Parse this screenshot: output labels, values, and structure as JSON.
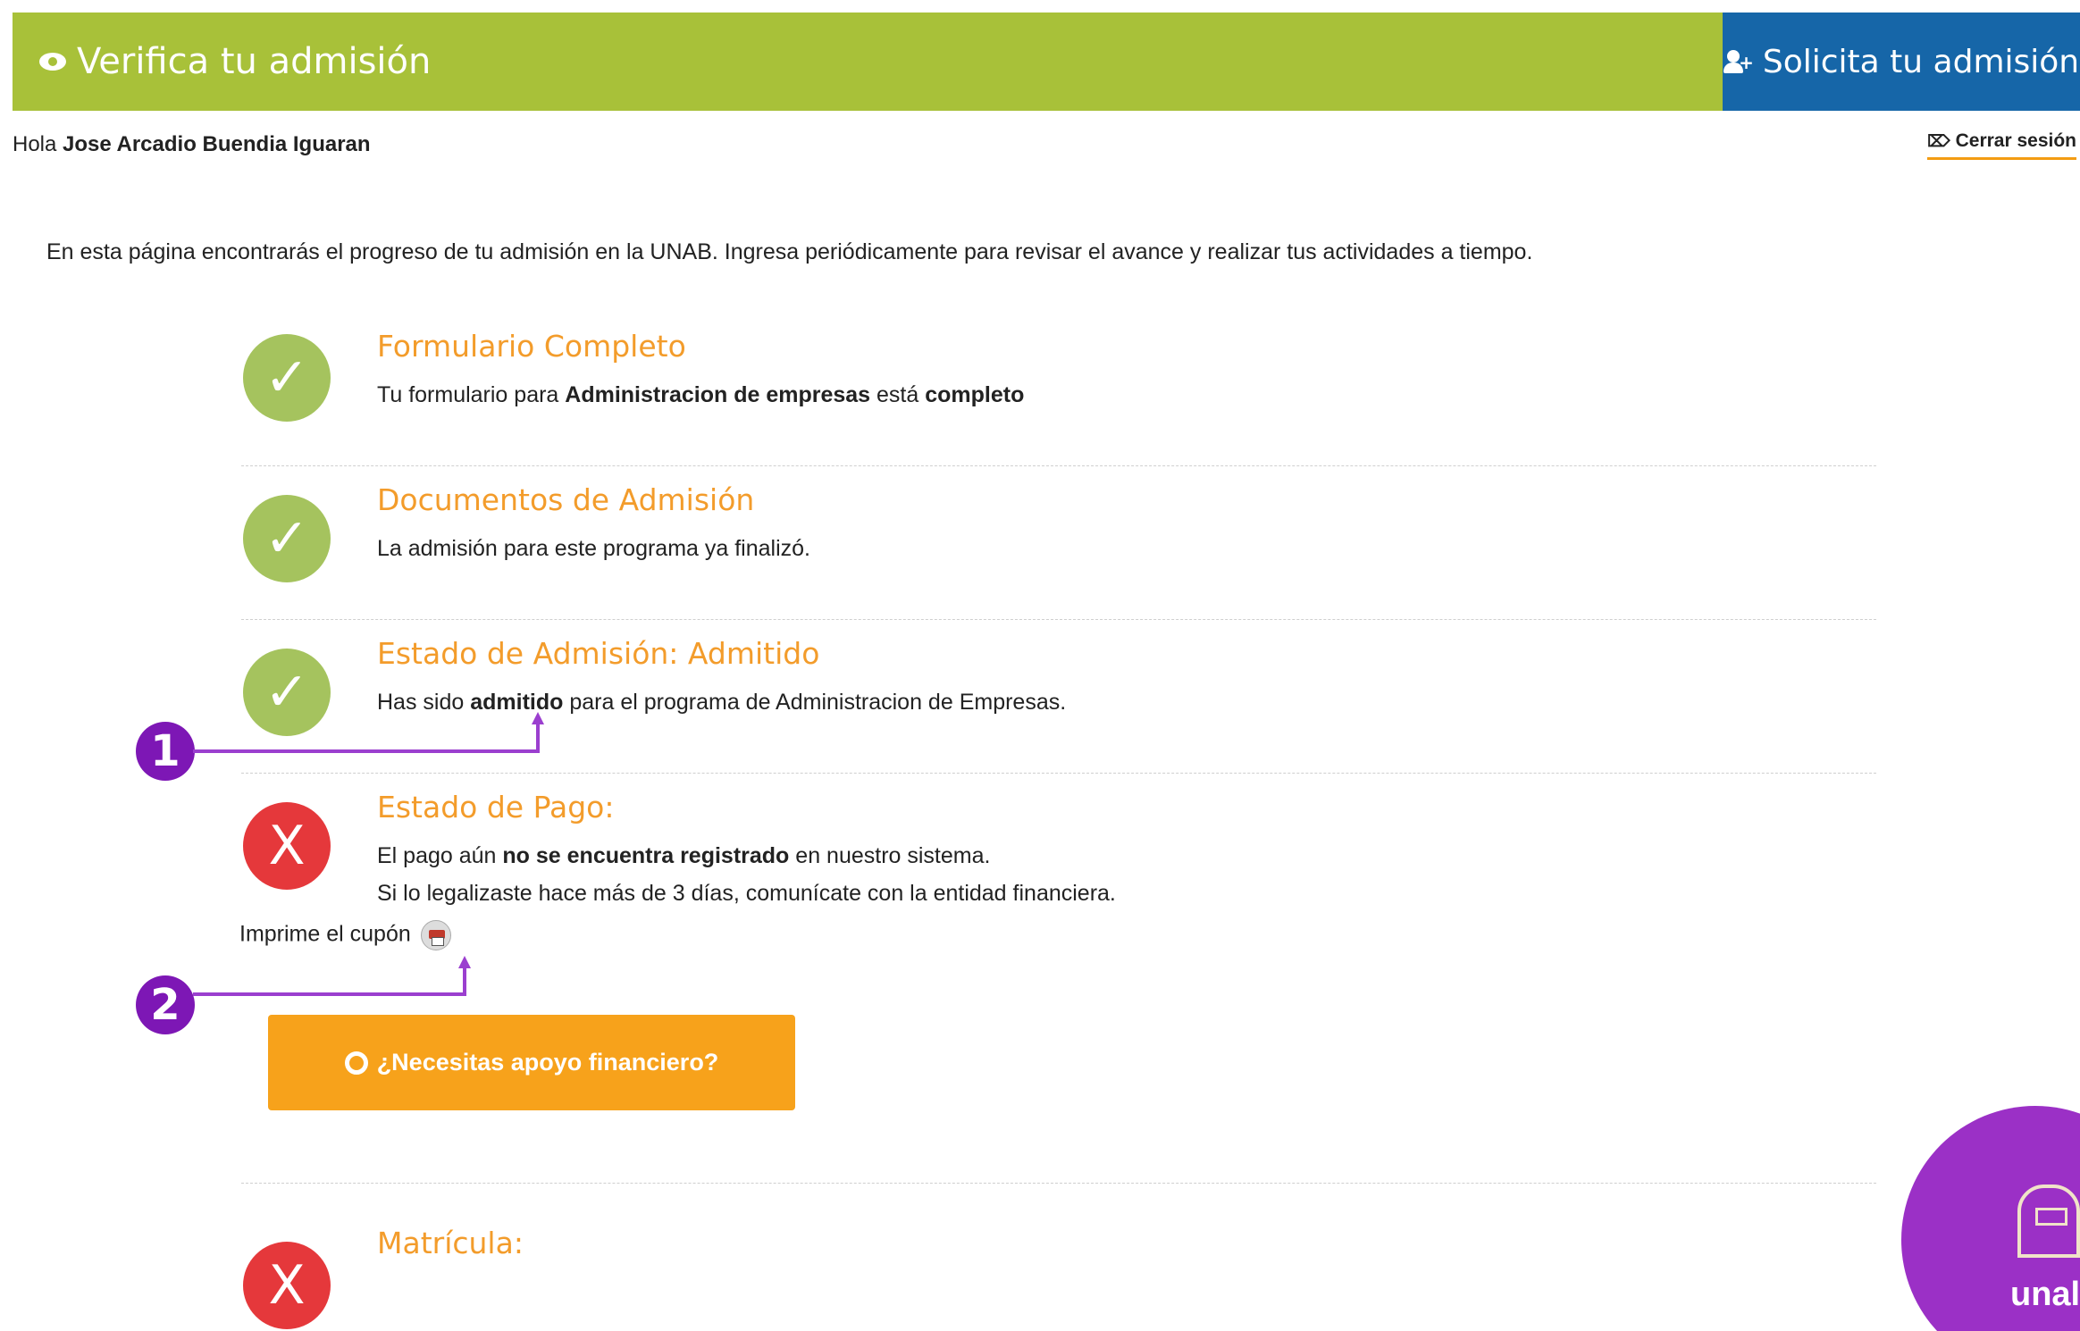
{
  "header": {
    "title": "Verifica tu admisión",
    "cta_label": "Solicita tu admisión"
  },
  "user": {
    "greeting_prefix": "Hola",
    "name": "Jose Arcadio Buendia Iguaran",
    "logout_label": "Cerrar sesión"
  },
  "intro": "En esta página encontrarás el progreso de tu admisión en la UNAB. Ingresa periódicamente para revisar el avance y realizar tus actividades a tiempo.",
  "steps": [
    {
      "status": "ok",
      "title": "Formulario Completo",
      "text_a": "Tu formulario para ",
      "text_b": "Administracion de empresas",
      "text_c": " está ",
      "text_d": "completo"
    },
    {
      "status": "ok",
      "title": "Documentos de Admisión",
      "text": "La admisión para este programa ya finalizó."
    },
    {
      "status": "ok",
      "title": "Estado de Admisión: Admitido",
      "text_a": "Has sido ",
      "text_b": "admitido",
      "text_c": " para el programa de Administracion de Empresas."
    },
    {
      "status": "no",
      "title": "Estado de Pago:",
      "line1_a": "El pago aún ",
      "line1_b": "no se encuentra registrado",
      "line1_c": " en nuestro sistema.",
      "line2": "Si lo legalizaste hace más de 3 días, comunícate con la entidad financiera."
    },
    {
      "status": "no",
      "title": "Matrícula:"
    }
  ],
  "print": {
    "label": "Imprime el cupón"
  },
  "financial_button": "¿Necesitas apoyo financiero?",
  "callouts": [
    "1",
    "2"
  ],
  "fab": {
    "label": "unal"
  },
  "icons": {
    "ok": "✓",
    "no": "X",
    "logout": "⌦"
  },
  "colors": {
    "header_green": "#a8c139",
    "cta_blue": "#1666a8",
    "title_orange": "#f39c2b",
    "ok_green": "#a5c35e",
    "error_red": "#e5383b",
    "button_orange": "#f7a21b",
    "callout_purple": "#7d17b5"
  }
}
